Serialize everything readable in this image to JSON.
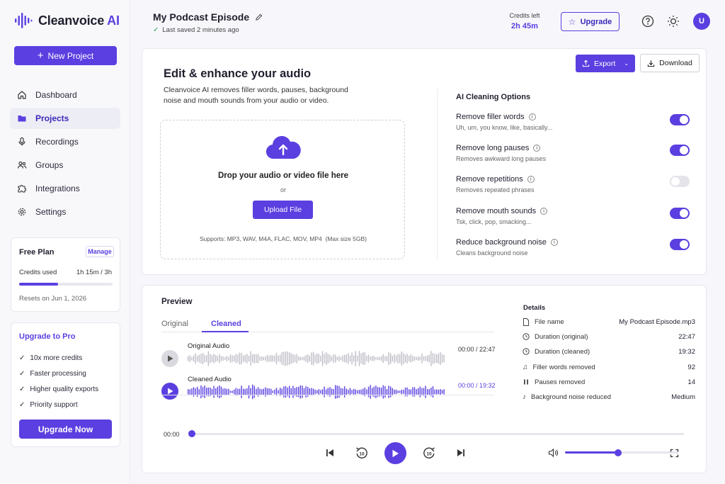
{
  "app": {
    "name_main": "Cleanvoice",
    "name_accent": " AI"
  },
  "sidebar": {
    "new_project": "New Project",
    "items": [
      {
        "label": "Dashboard",
        "icon": "home-icon"
      },
      {
        "label": "Projects",
        "icon": "folder-icon",
        "active": true
      },
      {
        "label": "Recordings",
        "icon": "microphone-icon"
      },
      {
        "label": "Groups",
        "icon": "users-icon"
      },
      {
        "label": "Integrations",
        "icon": "puzzle-icon"
      },
      {
        "label": "Settings",
        "icon": "gear-icon"
      }
    ],
    "plan": {
      "title": "Free Plan",
      "manage": "Manage",
      "credits_label": "Credits used",
      "credits_value": "1h 15m / 3h",
      "credits_fraction": 0.42,
      "resets": "Resets on Jun 1, 2026"
    },
    "upgrade": {
      "title": "Upgrade to Pro",
      "features": [
        "10x more credits",
        "Faster processing",
        "Higher quality exports",
        "Priority support"
      ],
      "button": "Upgrade Now"
    }
  },
  "header": {
    "title": "My Podcast Episode",
    "saved": "Last saved 2 minutes ago",
    "credits_label": "Credits left",
    "credits_value": "2h 45m",
    "upgrade": "Upgrade",
    "avatar": "U"
  },
  "editor": {
    "export": "Export",
    "download": "Download",
    "title": "Edit & enhance your audio",
    "description": "Cleanvoice AI removes filler words, pauses, background noise and mouth sounds from your audio or video.",
    "drop_title": "Drop your audio or video file here",
    "or": "or",
    "upload": "Upload File",
    "supports": "Supports: MP3, WAV, M4A, FLAC, MOV, MP4  (Max size 5GB)"
  },
  "options": {
    "title": "AI Cleaning Options",
    "items": [
      {
        "title": "Remove filler words",
        "sub": "Uh, um, you know, like, basically...",
        "on": true
      },
      {
        "title": "Remove long pauses",
        "sub": "Removes awkward long pauses",
        "on": true
      },
      {
        "title": "Remove repetitions",
        "sub": "Removes repeated phrases",
        "on": false
      },
      {
        "title": "Remove mouth sounds",
        "sub": "Tsk, click, pop, smacking...",
        "on": true
      },
      {
        "title": "Reduce background noise",
        "sub": "Cleans background noise",
        "on": true
      }
    ]
  },
  "preview": {
    "title": "Preview",
    "tabs": [
      {
        "label": "Original"
      },
      {
        "label": "Cleaned",
        "active": true
      }
    ],
    "original_label": "Original Audio",
    "original_time": "00:00 / 22:47",
    "cleaned_label": "Cleaned Audio",
    "cleaned_time": "00:00 / 19:32",
    "position": "00:00",
    "volume_fraction": 0.47
  },
  "details": {
    "title": "Details",
    "rows": [
      {
        "label": "File name",
        "value": "My Podcast Episode.mp3",
        "icon": "file-icon"
      },
      {
        "label": "Duration (original)",
        "value": "22:47",
        "icon": "clock-icon"
      },
      {
        "label": "Duration (cleaned)",
        "value": "19:32",
        "icon": "clock-icon"
      },
      {
        "label": "Filler words removed",
        "value": "92",
        "icon": "music-note-icon"
      },
      {
        "label": "Pauses removed",
        "value": "14",
        "icon": "pause-icon"
      },
      {
        "label": "Background noise reduced",
        "value": "Medium",
        "icon": "wave-icon"
      }
    ]
  },
  "colors": {
    "accent": "#5b3fe0",
    "success": "#2e9d55"
  }
}
